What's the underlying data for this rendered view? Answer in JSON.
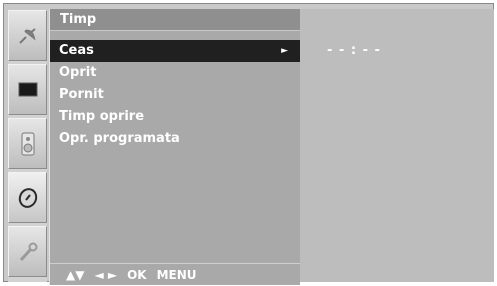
{
  "menu": {
    "title": "Timp",
    "items": [
      {
        "label": "Ceas",
        "selected": true,
        "arrow": "►"
      },
      {
        "label": "Oprit"
      },
      {
        "label": "Pornit"
      },
      {
        "label": "Timp oprire"
      },
      {
        "label": "Opr. programata"
      }
    ]
  },
  "help_bar": {
    "updown": "▲▼",
    "leftright": "◄ ►",
    "ok": "OK",
    "menu": "MENU"
  },
  "clock": {
    "value": "- - : - -"
  },
  "icons": [
    "satellite-dish-icon",
    "screen-icon",
    "speaker-icon",
    "clock-icon",
    "wrench-icon"
  ],
  "colors": {
    "selection": "#202020",
    "panel": "#a9a9a9",
    "text": "#ffffff"
  }
}
